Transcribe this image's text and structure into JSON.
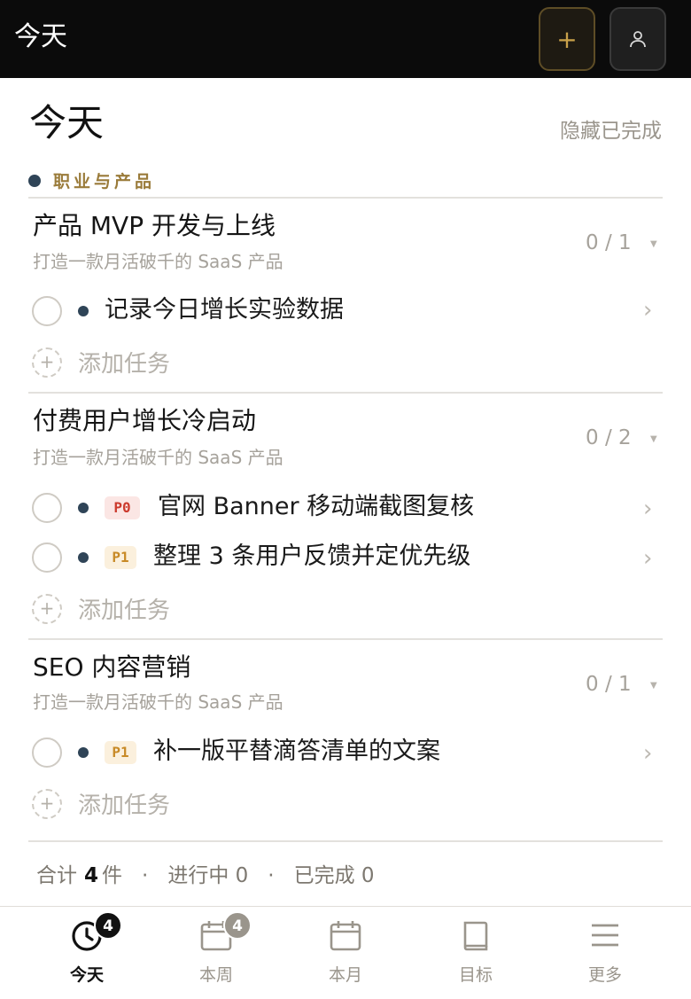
{
  "header": {
    "title": "今天"
  },
  "page": {
    "title": "今天",
    "hide_completed": "隐藏已完成"
  },
  "category": {
    "label": "职业与产品",
    "dot_color": "#2f4457"
  },
  "projects": [
    {
      "title": "产品 MVP 开发与上线",
      "subtitle": "打造一款月活破千的 SaaS 产品",
      "count": "0 / 1",
      "tasks": [
        {
          "text": "记录今日增长实验数据",
          "priority": ""
        }
      ]
    },
    {
      "title": "付费用户增长冷启动",
      "subtitle": "打造一款月活破千的 SaaS 产品",
      "count": "0 / 2",
      "tasks": [
        {
          "text": "官网 Banner 移动端截图复核",
          "priority": "P0"
        },
        {
          "text": "整理 3 条用户反馈并定优先级",
          "priority": "P1"
        }
      ]
    },
    {
      "title": "SEO 内容营销",
      "subtitle": "打造一款月活破千的 SaaS 产品",
      "count": "0 / 1",
      "tasks": [
        {
          "text": "补一版平替滴答清单的文案",
          "priority": "P1"
        }
      ]
    }
  ],
  "add_task_label": "添加任务",
  "summary": {
    "total_prefix": "合计",
    "total": "4",
    "total_suffix": "件",
    "in_progress": "进行中 0",
    "completed": "已完成 0",
    "separator": "·"
  },
  "tabs": [
    {
      "label": "今天",
      "icon": "clock-icon",
      "badge": "4",
      "active": true
    },
    {
      "label": "本周",
      "icon": "calendar-week-icon",
      "badge": "4",
      "active": false
    },
    {
      "label": "本月",
      "icon": "calendar-month-icon",
      "badge": "",
      "active": false
    },
    {
      "label": "目标",
      "icon": "book-icon",
      "badge": "",
      "active": false
    },
    {
      "label": "更多",
      "icon": "menu-icon",
      "badge": "",
      "active": false
    }
  ],
  "colors": {
    "topbar_bg": "#0b0b0b",
    "accent_gold": "#c9a14a",
    "p0_text": "#cc3b2e",
    "p1_text": "#c88a27",
    "badge_active": "#111111",
    "badge_inactive": "#9a958c"
  }
}
